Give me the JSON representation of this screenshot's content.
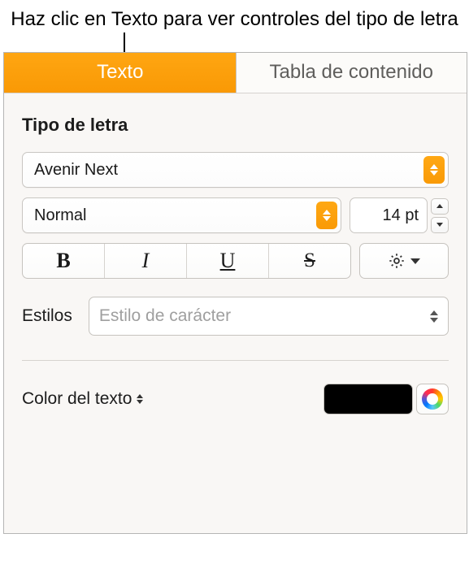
{
  "callout": "Haz clic en Texto para ver controles del tipo de letra",
  "tabs": {
    "text": "Texto",
    "toc": "Tabla de contenido"
  },
  "font": {
    "header": "Tipo de letra",
    "family": "Avenir Next",
    "style": "Normal",
    "size": "14 pt"
  },
  "format_buttons": {
    "bold": "B",
    "italic": "I",
    "underline": "U",
    "strike": "S"
  },
  "styles": {
    "label": "Estilos",
    "placeholder": "Estilo de carácter"
  },
  "text_color": {
    "label": "Color del texto",
    "value": "#000000"
  }
}
